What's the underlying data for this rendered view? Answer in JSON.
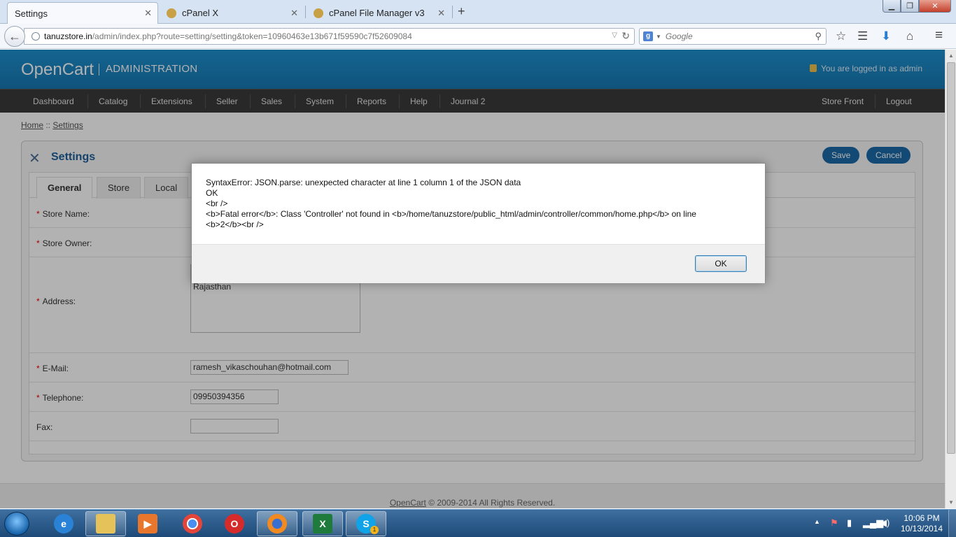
{
  "browser": {
    "tabs": [
      {
        "title": "Settings"
      },
      {
        "title": "cPanel X"
      },
      {
        "title": "cPanel File Manager v3"
      }
    ],
    "url_domain": "tanuzstore.in",
    "url_path": "/admin/index.php?route=setting/setting&token=10960463e13b671f59590c7f52609084",
    "search_placeholder": "Google"
  },
  "header": {
    "logo": "OpenCart",
    "admin": "ADMINISTRATION",
    "logged_in": "You are logged in as admin"
  },
  "menu": {
    "left": [
      "Dashboard",
      "Catalog",
      "Extensions",
      "Seller",
      "Sales",
      "System",
      "Reports",
      "Help",
      "Journal 2"
    ],
    "right": [
      "Store Front",
      "Logout"
    ]
  },
  "breadcrumb": {
    "home": "Home",
    "sep": " :: ",
    "current": "Settings"
  },
  "box": {
    "title": "Settings",
    "save": "Save",
    "cancel": "Cancel"
  },
  "form_tabs": [
    "General",
    "Store",
    "Local"
  ],
  "form": {
    "store_name_label": "Store Name:",
    "store_owner_label": "Store Owner:",
    "address_label": "Address:",
    "address_value": "Rajasthan",
    "email_label": "E-Mail:",
    "email_value": "ramesh_vikaschouhan@hotmail.com",
    "telephone_label": "Telephone:",
    "telephone_value": "09950394356",
    "fax_label": "Fax:",
    "fax_value": "",
    "required_mark": "*"
  },
  "footer": {
    "link": "OpenCart",
    "text": " © 2009-2014 All Rights Reserved."
  },
  "dialog": {
    "lines": [
      "SyntaxError: JSON.parse: unexpected character at line 1 column 1 of the JSON data",
      "OK",
      "<br />",
      "<b>Fatal error</b>:  Class 'Controller' not found in <b>/home/tanuzstore/public_html/admin/controller/common/home.php</b> on line",
      "<b>2</b><br />"
    ],
    "ok_button": "OK"
  },
  "taskbar": {
    "time": "10:06 PM",
    "date": "10/13/2014",
    "skype_badge": "1"
  }
}
